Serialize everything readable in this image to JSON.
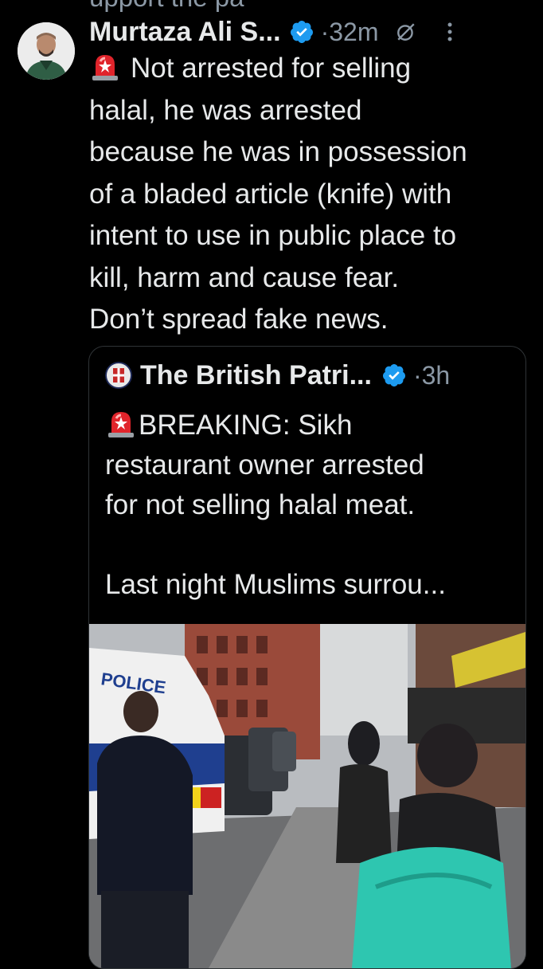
{
  "previous_tweet": {
    "cut_text": "upport the pa  "
  },
  "tweet": {
    "author_name": "Murtaza Ali S...",
    "time": "·32m",
    "lines": [
      "Not arrested for selling",
      "halal, he was arrested",
      "because he was in possession",
      "of a bladed article (knife) with",
      "intent to use in public place to",
      "kill, harm and cause fear.",
      "Don’t spread fake news."
    ],
    "icons": {
      "siren": "police-light-emoji",
      "verified": "verified-badge-icon",
      "grok": "grok-icon",
      "more": "more-vertical-icon"
    }
  },
  "quoted_tweet": {
    "author_name": "The British Patri...",
    "time": "·3h",
    "lines": [
      "BREAKING: Sikh",
      "restaurant owner arrested",
      "for not selling halal meat.",
      "",
      "Last night Muslims surrou..."
    ],
    "media": {
      "van_text": "POLICE"
    }
  },
  "colors": {
    "background": "#000000",
    "text": "#e7e9ea",
    "muted": "#8b98a5",
    "verified": "#1d9bf0",
    "border": "#2f3336"
  }
}
